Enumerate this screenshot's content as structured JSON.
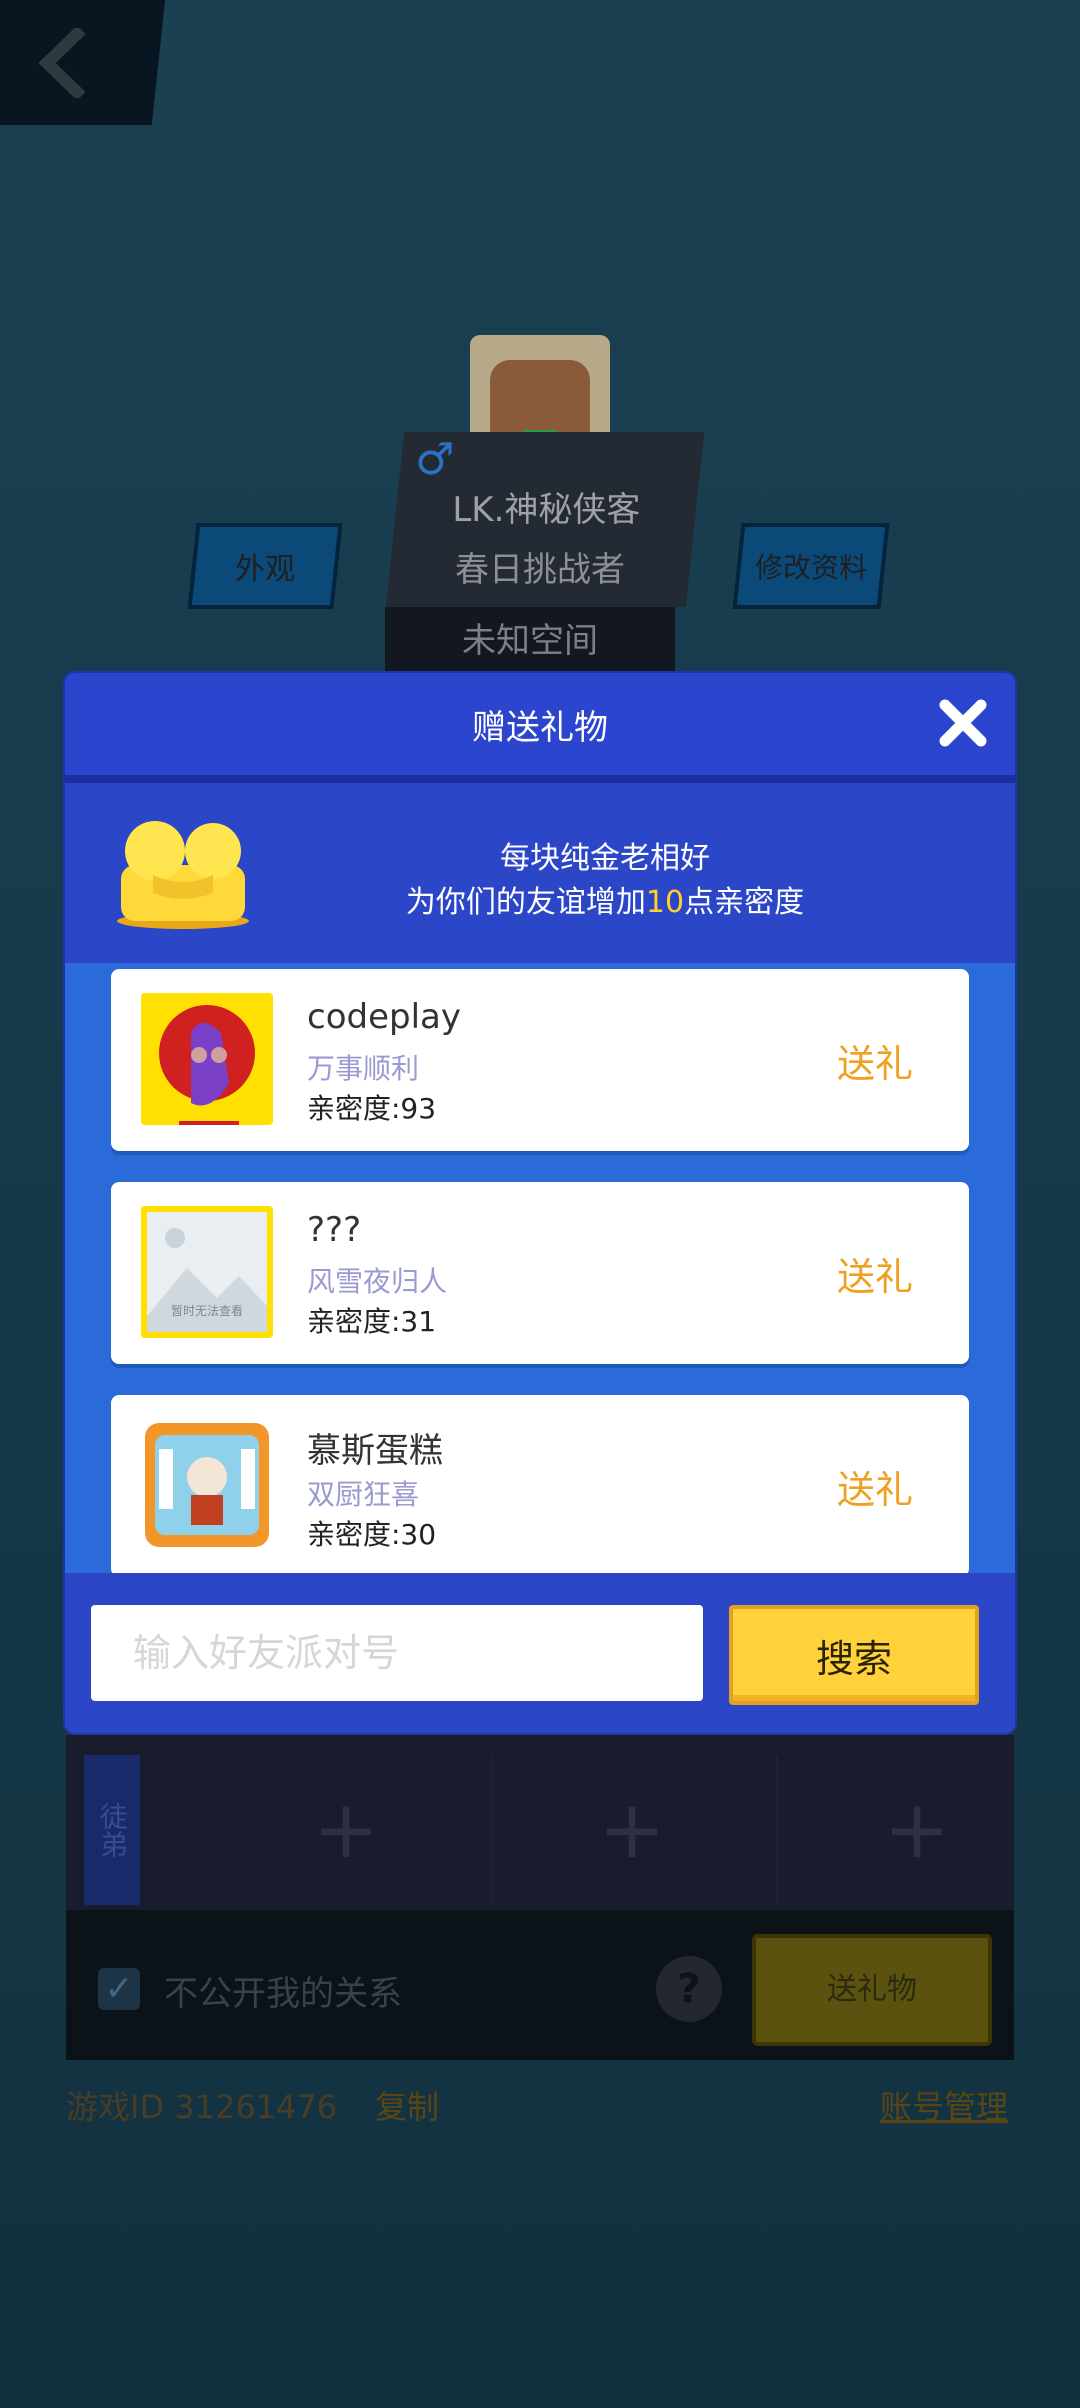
{
  "profile": {
    "name": "LK.神秘侠客",
    "title": "春日挑战者",
    "location": "未知空间",
    "appearance_label": "外观",
    "edit_label": "修改资料"
  },
  "dialog": {
    "title": "赠送礼物",
    "banner_line1": "每块纯金老相好",
    "banner_line2_pre": "为你们的友谊增加",
    "banner_line2_num": "10",
    "banner_line2_post": "点亲密度",
    "friends": [
      {
        "name": "codeplay",
        "title": "万事顺利",
        "affinity": "亲密度:93",
        "action": "送礼"
      },
      {
        "name": "???",
        "title": "风雪夜归人",
        "affinity": "亲密度:31",
        "action": "送礼",
        "thumb_text": "暂时无法查看"
      },
      {
        "name": "慕斯蛋糕",
        "title": "双厨狂喜",
        "affinity": "亲密度:30",
        "action": "送礼"
      }
    ],
    "search_placeholder": "输入好友派对号",
    "search_button": "搜索"
  },
  "relations": {
    "slot_tag": "徒弟",
    "hide_label": "不公开我的关系",
    "gift_button": "送礼物"
  },
  "footer": {
    "game_id": "游戏ID 31261476",
    "copy": "复制",
    "account": "账号管理"
  },
  "colors": {
    "dialog_bg": "#2b47c8",
    "list_bg": "#2a6bd9",
    "accent": "#f0a020",
    "highlight": "#ffcf2e",
    "search_btn": "#ffd23c"
  }
}
